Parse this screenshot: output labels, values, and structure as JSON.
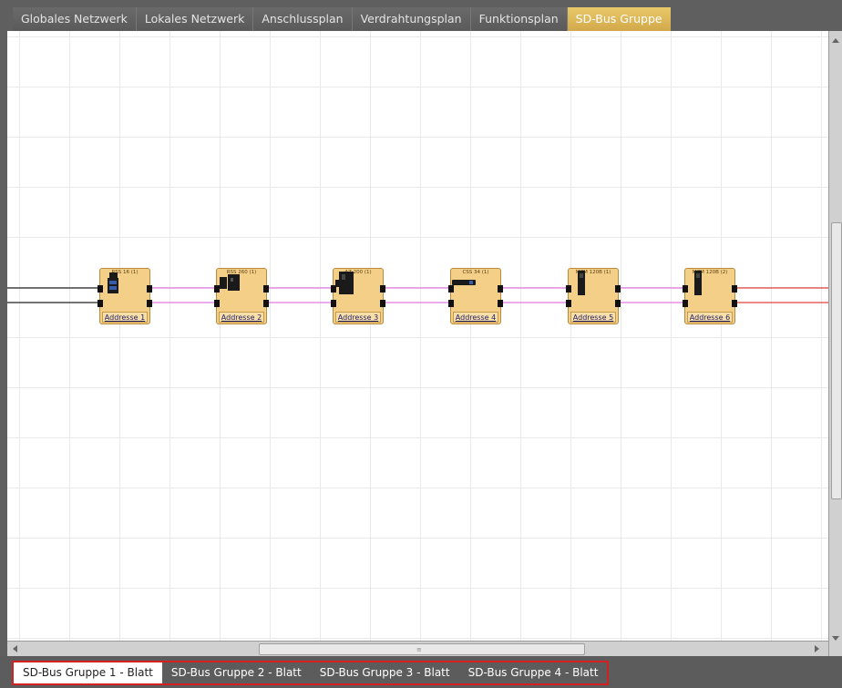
{
  "top_tabs": [
    {
      "label": "Globales Netzwerk",
      "active": false
    },
    {
      "label": "Lokales Netzwerk",
      "active": false
    },
    {
      "label": "Anschlussplan",
      "active": false
    },
    {
      "label": "Verdrahtungsplan",
      "active": false
    },
    {
      "label": "Funktionsplan",
      "active": false
    },
    {
      "label": "SD-Bus Gruppe",
      "active": true
    }
  ],
  "modules": [
    {
      "title": "RSS 16 (1)",
      "address": "Addresse 1",
      "icon": "sensor-icon"
    },
    {
      "title": "RSS 260 (1)",
      "address": "Addresse 2",
      "icon": "safety-switch-icon"
    },
    {
      "title": "AZ 200 (1)",
      "address": "Addresse 3",
      "icon": "door-lock-icon"
    },
    {
      "title": "CSS 34 (1)",
      "address": "Addresse 4",
      "icon": "coded-sensor-icon"
    },
    {
      "title": "MZM 120B (1)",
      "address": "Addresse 5",
      "icon": "solenoid-lock-icon"
    },
    {
      "title": "MZM 120B (2)",
      "address": "Addresse 6",
      "icon": "solenoid-lock-icon"
    }
  ],
  "colors": {
    "bus_line_pink": "#e07ae0",
    "input_line": "#222222",
    "output_line_red": "#e04040",
    "active_tab": "#e0bc5c",
    "sheet_highlight": "#d42020"
  },
  "sheet_tabs": [
    {
      "label": "SD-Bus Gruppe 1 - Blatt",
      "active": true
    },
    {
      "label": "SD-Bus Gruppe 2 - Blatt",
      "active": false
    },
    {
      "label": "SD-Bus Gruppe 3 - Blatt",
      "active": false
    },
    {
      "label": "SD-Bus Gruppe 4 - Blatt",
      "active": false
    }
  ]
}
